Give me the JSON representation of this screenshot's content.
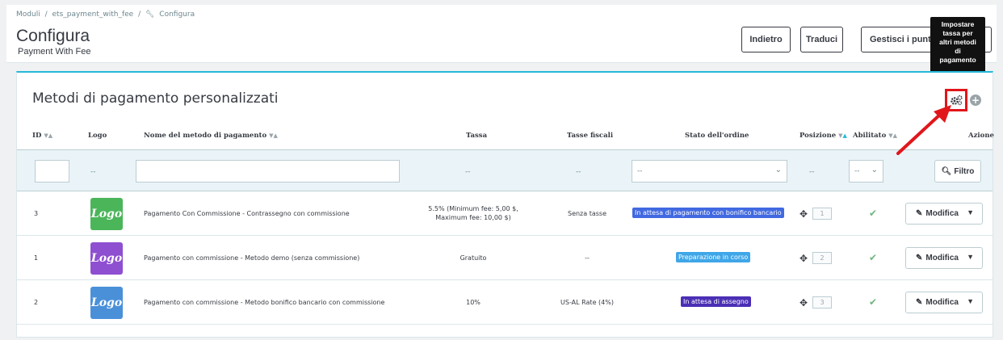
{
  "breadcrumb": {
    "items": [
      "Moduli",
      "/",
      "ets_payment_with_fee",
      "/",
      "Configura"
    ]
  },
  "page": {
    "title": "Configura",
    "subtitle": "Payment With Fee"
  },
  "toolbar": {
    "back_label": "Indietro",
    "translate_label": "Traduci",
    "manage_points_label": "Gestisci i punti c",
    "manage_points_tail": "o"
  },
  "tooltip": {
    "text": "Impostare\ntassa per\naltri metodi\ndi\npagamento"
  },
  "panel": {
    "title": "Metodi di pagamento personalizzati"
  },
  "table": {
    "headers": {
      "id": "ID",
      "logo": "Logo",
      "name": "Nome del metodo di pagamento",
      "fee": "Tassa",
      "tax": "Tasse fiscali",
      "status": "Stato dell'ordine",
      "position": "Posizione",
      "enabled": "Abilitato",
      "action": "Azione"
    },
    "filters": {
      "id_value": "",
      "logo_dash": "--",
      "name_value": "",
      "fee_dash": "--",
      "tax_dash": "--",
      "status_value": "--",
      "position_dash": "--",
      "enabled_value": "--",
      "filter_button": "Filtro"
    },
    "rows": [
      {
        "id": "3",
        "logo_text": "Logo",
        "logo_color": "#4bb55a",
        "name": "Pagamento Con Commissione - Contrassegno con commissione",
        "fee_line1": "5.5% (Minimum fee: 5,00 $,",
        "fee_line2": "Maximum fee: 10,00 $)",
        "tax": "Senza tasse",
        "status": "In attesa di pagamento con bonifico bancario",
        "status_color": "#4169e1",
        "position": "1",
        "action": "Modifica"
      },
      {
        "id": "1",
        "logo_text": "Logo",
        "logo_color": "#8e4fd1",
        "name": "Pagamento con commissione - Metodo demo (senza commissione)",
        "fee_line1": "Gratuito",
        "fee_line2": "",
        "tax": "--",
        "status": "Preparazione in corso",
        "status_color": "#3fa6e8",
        "position": "2",
        "action": "Modifica"
      },
      {
        "id": "2",
        "logo_text": "Logo",
        "logo_color": "#4a90d9",
        "name": "Pagamento con commissione - Metodo bonifico bancario con commissione",
        "fee_line1": "10%",
        "fee_line2": "",
        "tax": "US-AL Rate (4%)",
        "status": "In attesa di assegno",
        "status_color": "#4b2fb5",
        "position": "3",
        "action": "Modifica"
      }
    ]
  },
  "colors": {
    "accent": "#25b9d7",
    "highlight": "#e0161b",
    "check": "#70b580"
  }
}
